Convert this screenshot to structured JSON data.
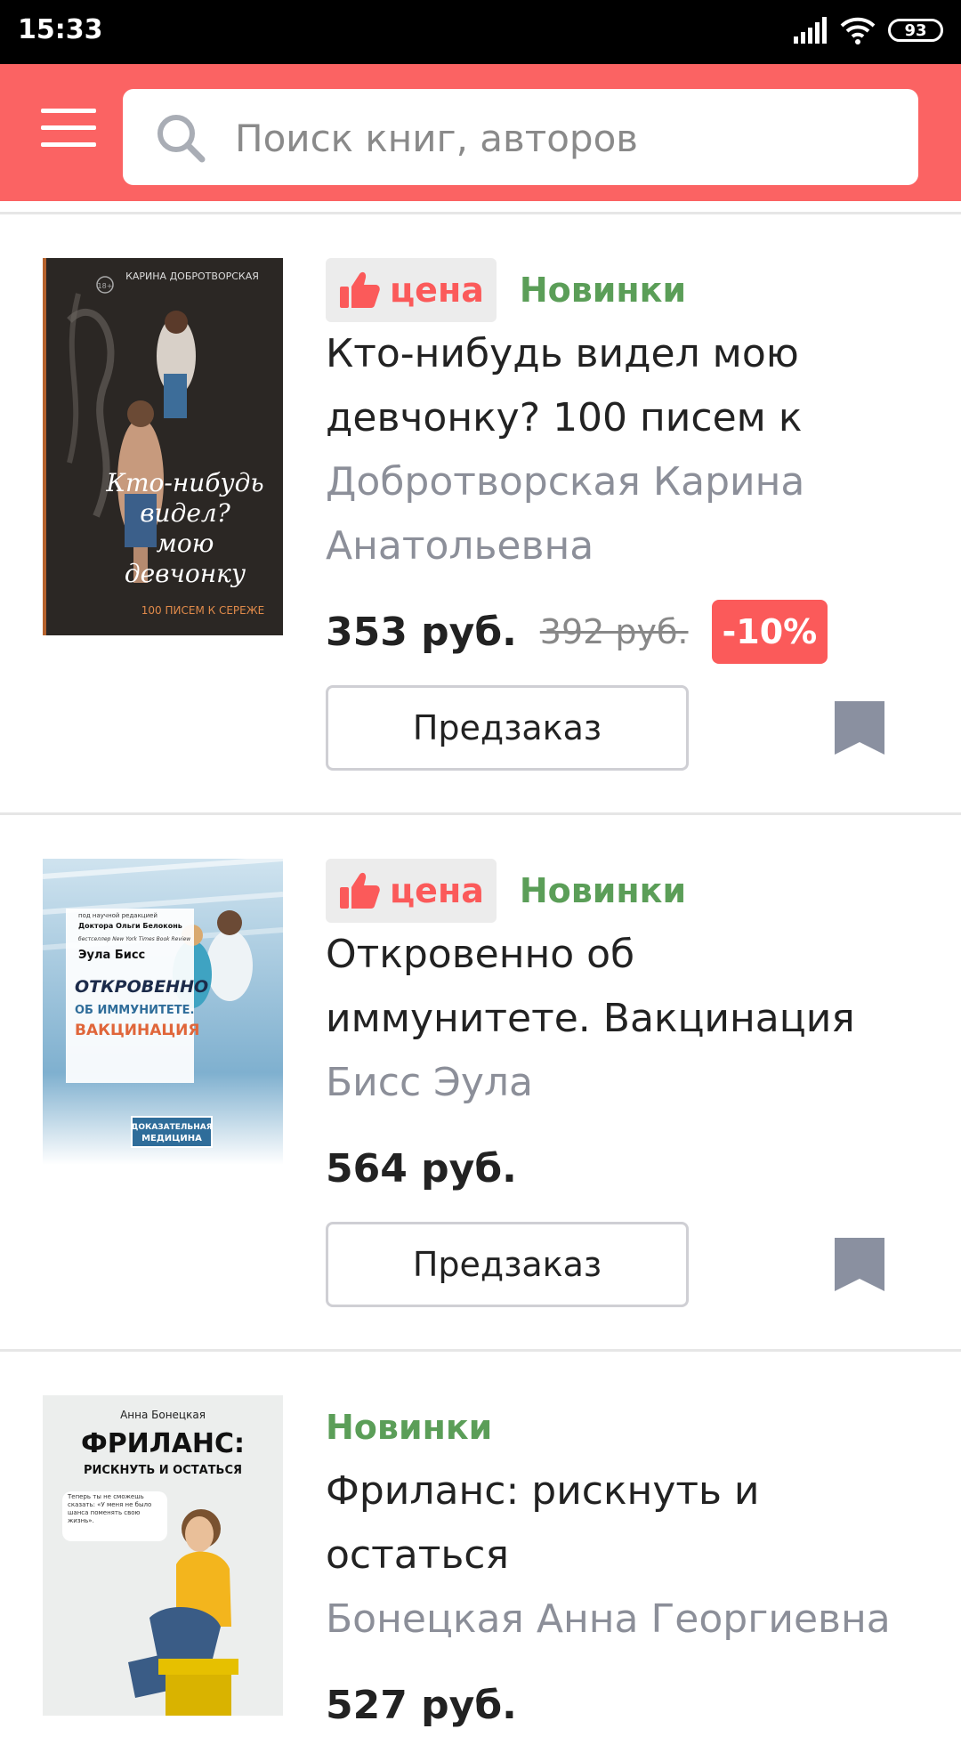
{
  "status_bar": {
    "time": "15:33",
    "battery": "93"
  },
  "search": {
    "placeholder": "Поиск книг, авторов"
  },
  "products": [
    {
      "deal_label": "цена",
      "tag": "Новинки",
      "title_line1": "Кто-нибудь видел мою",
      "title_line2": "девчонку? 100 писем к",
      "author_line1": "Добротворская Карина",
      "author_line2": "Анатольевна",
      "price": "353 руб.",
      "old_price": "392 руб.",
      "discount": "-10%",
      "button": "Предзаказ",
      "cover": {
        "author": "КАРИНА ДОБРОТВОРСКАЯ",
        "title_lines": [
          "Кто-нибудь",
          "видел?",
          "мою",
          "девчонку"
        ],
        "subtitle": "100 ПИСЕМ К СЕРЕЖЕ",
        "age": "18+"
      }
    },
    {
      "deal_label": "цена",
      "tag": "Новинки",
      "title_line1": "Откровенно об",
      "title_line2": "иммунитете. Вакцинация",
      "author_line1": "Бисс Эула",
      "price": "564 руб.",
      "button": "Предзаказ",
      "cover": {
        "editor_line1": "под научной редакцией",
        "editor_line2": "Доктора Ольги Белоконь",
        "bestseller": "бестселлер New York Times Book Review",
        "author": "Эула Бисс",
        "title_lines": [
          "ОТКРОВЕННО",
          "ОБ ИММУНИТЕТЕ.",
          "ВАКЦИНАЦИЯ"
        ],
        "series_line1": "ДОКАЗАТЕЛЬНАЯ",
        "series_line2": "МЕДИЦИНА"
      }
    },
    {
      "tag": "Новинки",
      "title_line1": "Фриланс: рискнуть и",
      "title_line2": "остаться",
      "author_line1": "Бонецкая Анна Георгиевна",
      "price": "527 руб.",
      "cover": {
        "author": "Анна Бонецкая",
        "title": "ФРИЛАНС:",
        "subtitle": "РИСКНУТЬ И ОСТАТЬСЯ",
        "quote": "Теперь ты не сможешь сказать: «У меня не было шанса поменять свою жизнь»."
      }
    }
  ],
  "colors": {
    "accent": "#fb6363",
    "tag_green": "#5b9e58",
    "author_gray": "#8c8f99",
    "bookmark": "#8a90a0"
  }
}
